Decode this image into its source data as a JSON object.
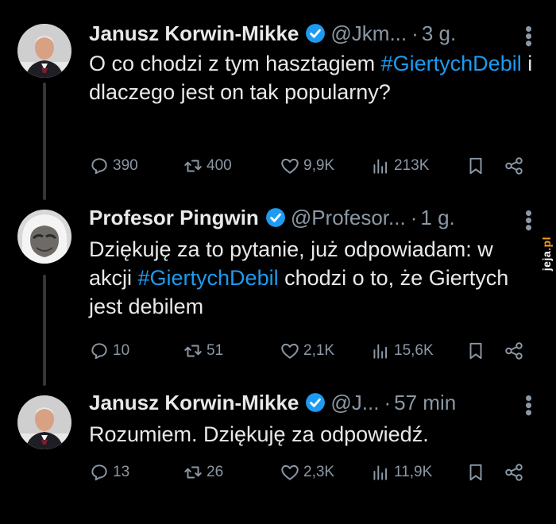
{
  "tweets": [
    {
      "name": "Janusz Korwin-Mikke",
      "handle": "@Jkm...",
      "time": "3 g.",
      "parts": [
        {
          "t": "O co chodzi z tym hasztagiem "
        },
        {
          "t": "#GiertychDebil",
          "tag": true
        },
        {
          "t": " i dlaczego jest on tak popularny?"
        }
      ],
      "replies": "390",
      "reposts": "400",
      "likes": "9,9K",
      "views": "213K"
    },
    {
      "name": "Profesor Pingwin",
      "handle": "@Profesor...",
      "time": "1 g.",
      "parts": [
        {
          "t": "Dziękuję za to pytanie, już odpowiadam: w akcji "
        },
        {
          "t": "#GiertychDebil",
          "tag": true
        },
        {
          "t": " chodzi o to, że Giertych jest debilem"
        }
      ],
      "replies": "10",
      "reposts": "51",
      "likes": "2,1K",
      "views": "15,6K"
    },
    {
      "name": "Janusz Korwin-Mikke",
      "handle": "@J...",
      "time": "57 min",
      "parts": [
        {
          "t": "Rozumiem. Dziękuję za odpowiedź."
        }
      ],
      "replies": "13",
      "reposts": "26",
      "likes": "2,3K",
      "views": "11,9K"
    }
  ],
  "separator": "·",
  "watermark": {
    "brand": "jeja",
    "tld": ".pl"
  },
  "icons": [
    "verified-badge-icon",
    "more-icon",
    "reply-icon",
    "repost-icon",
    "like-icon",
    "views-icon",
    "bookmark-icon",
    "share-icon"
  ],
  "colors": {
    "accent": "#1d9bf0",
    "muted": "#8b98a5",
    "background": "#000000"
  }
}
